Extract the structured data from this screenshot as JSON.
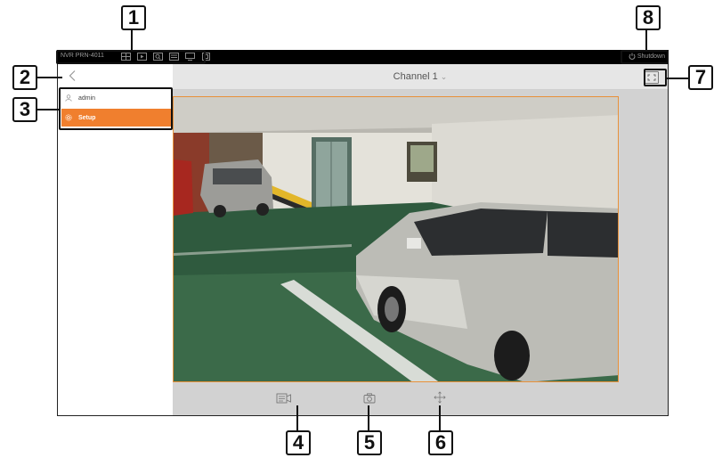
{
  "topbar": {
    "model": "NVR PRN-4011",
    "icons": [
      "layout-icon",
      "playback-icon",
      "search-icon",
      "backup-icon",
      "monitor-icon",
      "screen-icon"
    ],
    "shutdown_label": "Shutdown"
  },
  "left_panel": {
    "user": {
      "label": "admin",
      "icon": "user-icon"
    },
    "setup": {
      "label": "Setup",
      "icon": "gear-icon"
    },
    "back_icon": "chevron-left-icon"
  },
  "main": {
    "channel_title": "Channel 1",
    "fullscreen_icon": "fullscreen-icon",
    "bottom_icons": [
      "record-icon",
      "camera-icon",
      "ptz-move-icon"
    ]
  },
  "callouts": {
    "c1": "1",
    "c2": "2",
    "c3": "3",
    "c4": "4",
    "c5": "5",
    "c6": "6",
    "c7": "7",
    "c8": "8"
  },
  "colors": {
    "accent": "#f07f2e",
    "topbar": "#000000",
    "main_bg": "#d2d2d2",
    "video_border": "#e8913a"
  }
}
